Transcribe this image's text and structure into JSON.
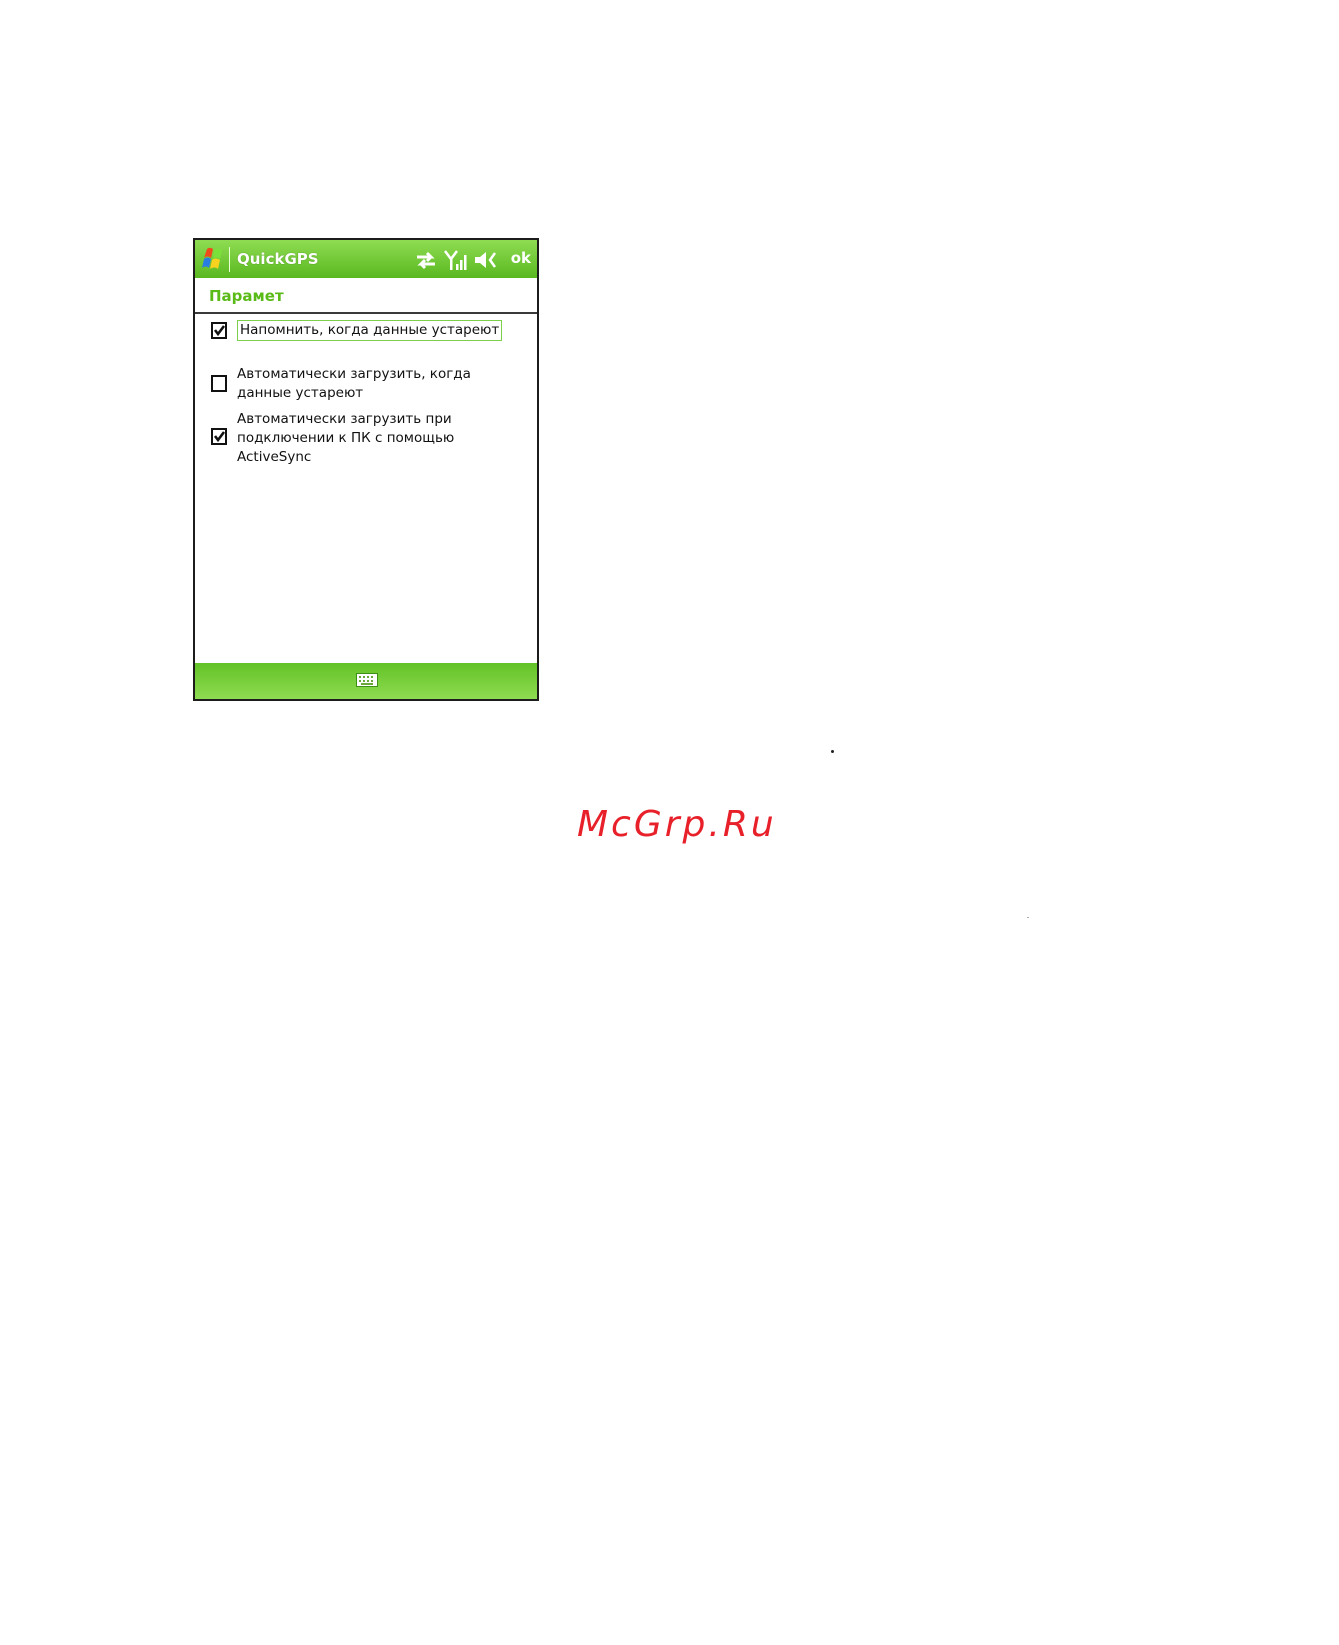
{
  "titlebar": {
    "app_title": "QuickGPS",
    "ok_label": "ok",
    "icons": [
      "windows-start-icon",
      "sync-icon",
      "signal-icon",
      "volume-icon"
    ]
  },
  "page": {
    "header": "Парамет"
  },
  "options": [
    {
      "lines": [
        "Напомнить, когда данные устареют"
      ],
      "checked": true,
      "focused": true
    },
    {
      "lines": [
        "Автоматически загрузить, когда",
        "данные устареют"
      ],
      "checked": false
    },
    {
      "lines": [
        "Автоматически загрузить при",
        "подключении к ПК с помощью",
        "ActiveSync"
      ],
      "checked": true
    }
  ],
  "bottombar": {
    "icon": "keyboard-icon"
  },
  "watermark": "McGrp.Ru",
  "colors": {
    "accent_green": "#5aba17",
    "bar_green": "#8fdc52",
    "watermark_red": "#e8202a"
  }
}
